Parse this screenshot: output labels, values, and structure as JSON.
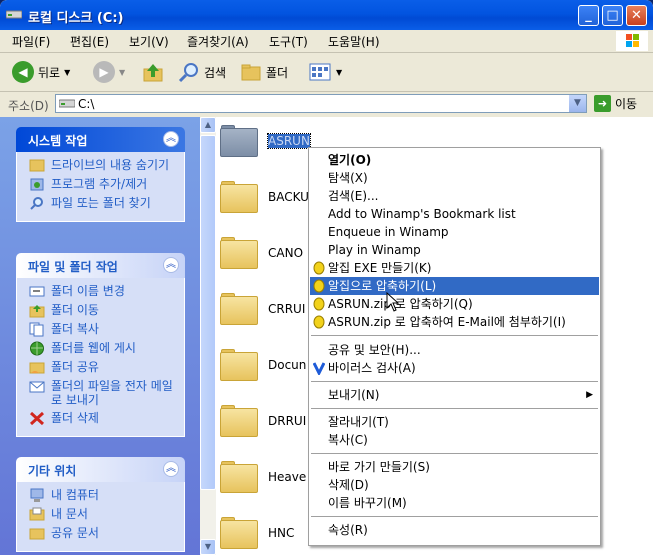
{
  "window": {
    "title": "로컬 디스크 (C:)"
  },
  "menubar": {
    "items": [
      "파일(F)",
      "편집(E)",
      "보기(V)",
      "즐겨찾기(A)",
      "도구(T)",
      "도움말(H)"
    ]
  },
  "toolbar": {
    "back_label": "뒤로",
    "search_label": "검색",
    "folders_label": "폴더"
  },
  "addressbar": {
    "label": "주소(D)",
    "value": "C:\\",
    "go_label": "이동"
  },
  "panels": {
    "system": {
      "title": "시스템 작업",
      "tasks": [
        "드라이브의 내용 숨기기",
        "프로그램 추가/제거",
        "파일 또는 폴더 찾기"
      ]
    },
    "file": {
      "title": "파일 및 폴더 작업",
      "tasks": [
        "폴더 이름 변경",
        "폴더 이동",
        "폴더 복사",
        "폴더를 웹에 게시",
        "폴더 공유",
        "폴더의 파일을 전자 메일로 보내기",
        "폴더 삭제"
      ]
    },
    "other": {
      "title": "기타 위치",
      "places": [
        "내 컴퓨터",
        "내 문서",
        "공유 문서"
      ]
    }
  },
  "folders": [
    "ASRUN",
    "BACKUP",
    "CANO",
    "CRRUI",
    "Docun",
    "DRRUI",
    "Heave",
    "HNC"
  ],
  "context_menu": {
    "items": [
      {
        "label": "열기(O)",
        "bold": true
      },
      {
        "label": "탐색(X)"
      },
      {
        "label": "검색(E)..."
      },
      {
        "label": "Add to Winamp's Bookmark list"
      },
      {
        "label": "Enqueue in Winamp"
      },
      {
        "label": "Play in Winamp"
      },
      {
        "label": "알집 EXE 만들기(K)",
        "icon": "alzip-icon"
      },
      {
        "label": "알집으로 압축하기(L)",
        "icon": "alzip-icon",
        "highlighted": true
      },
      {
        "label": "ASRUN.zip 로 압축하기(Q)",
        "icon": "alzip-icon"
      },
      {
        "label": "ASRUN.zip 로 압축하여 E-Mail에 첨부하기(I)",
        "icon": "alzip-icon"
      },
      {
        "label": "공유 및 보안(H)..."
      },
      {
        "label": "바이러스 검사(A)",
        "icon": "virus-scan-icon"
      },
      {
        "label": "보내기(N)",
        "submenu": true
      },
      {
        "label": "잘라내기(T)"
      },
      {
        "label": "복사(C)"
      },
      {
        "label": "바로 가기 만들기(S)"
      },
      {
        "label": "삭제(D)"
      },
      {
        "label": "이름 바꾸기(M)"
      },
      {
        "label": "속성(R)"
      }
    ]
  },
  "colors": {
    "title_blue": "#0254e0",
    "highlight": "#316ac5",
    "task_link": "#215dc6"
  }
}
